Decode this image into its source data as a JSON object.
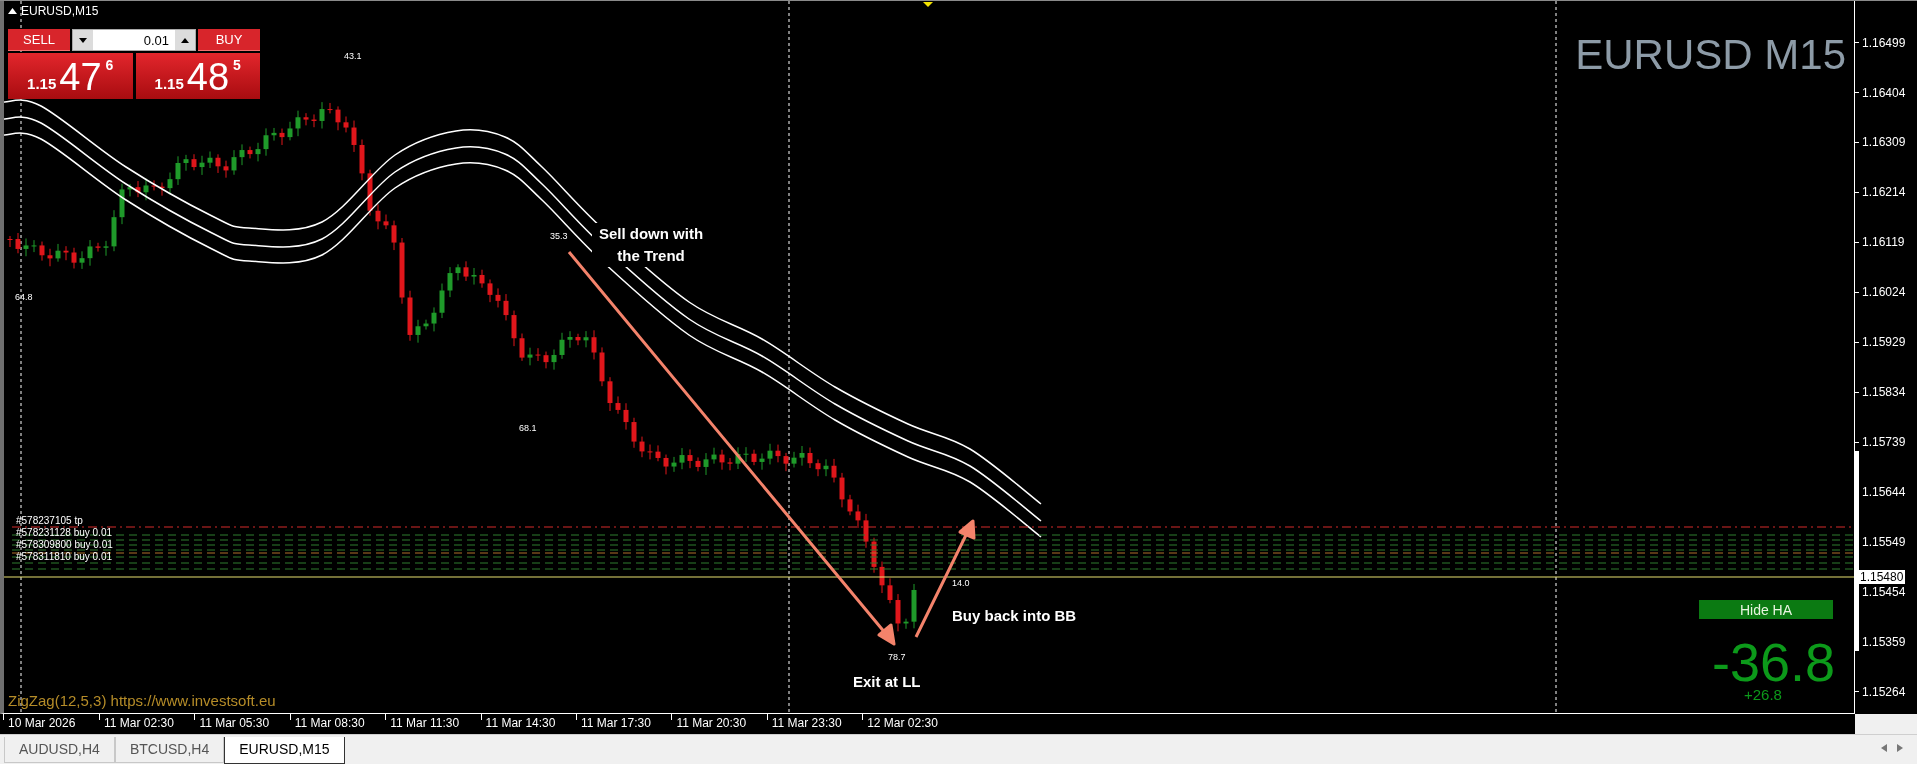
{
  "chart": {
    "symbol_label": "EURUSD,M15",
    "title": "EURUSD M15",
    "indicator_label": "ZigZag(12,5,3) https://www.investsoft.eu"
  },
  "trade_panel": {
    "sell_button": "SELL",
    "buy_button": "BUY",
    "lot": "0.01",
    "sell_price": {
      "prefix": "1.15",
      "main": "47",
      "pip": "6"
    },
    "buy_price": {
      "prefix": "1.15",
      "main": "48",
      "pip": "5"
    }
  },
  "zigzag_labels": [
    "43.1",
    "35.3",
    "64.8",
    "68.1",
    "78.7",
    "14.0"
  ],
  "annotations": [
    "Sell down with the Trend",
    "Exit at LL",
    "Buy back into BB"
  ],
  "order_lines": [
    "#578237105 tp",
    "#578231128 buy 0.01",
    "#578309800 buy 0.01",
    "#578311810 buy 0.01"
  ],
  "ha_button": "Hide HA",
  "profit": {
    "value": "-36.8",
    "change": "+26.8"
  },
  "price_axis": {
    "ticks": [
      "1.16499",
      "1.16404",
      "1.16309",
      "1.16214",
      "1.16119",
      "1.16024",
      "1.15929",
      "1.15834",
      "1.15739",
      "1.15644",
      "1.15549",
      "1.15454",
      "1.15359",
      "1.15264"
    ],
    "current_price": "1.15480"
  },
  "time_axis": [
    "10 Mar 2026",
    "11 Mar 02:30",
    "11 Mar 05:30",
    "11 Mar 08:30",
    "11 Mar 11:30",
    "11 Mar 14:30",
    "11 Mar 17:30",
    "11 Mar 20:30",
    "11 Mar 23:30",
    "12 Mar 02:30"
  ],
  "tabs": [
    {
      "label": "AUDUSD,H4",
      "selected": false
    },
    {
      "label": "BTCUSD,H4",
      "selected": false
    },
    {
      "label": "EURUSD,M15",
      "selected": true
    }
  ]
}
